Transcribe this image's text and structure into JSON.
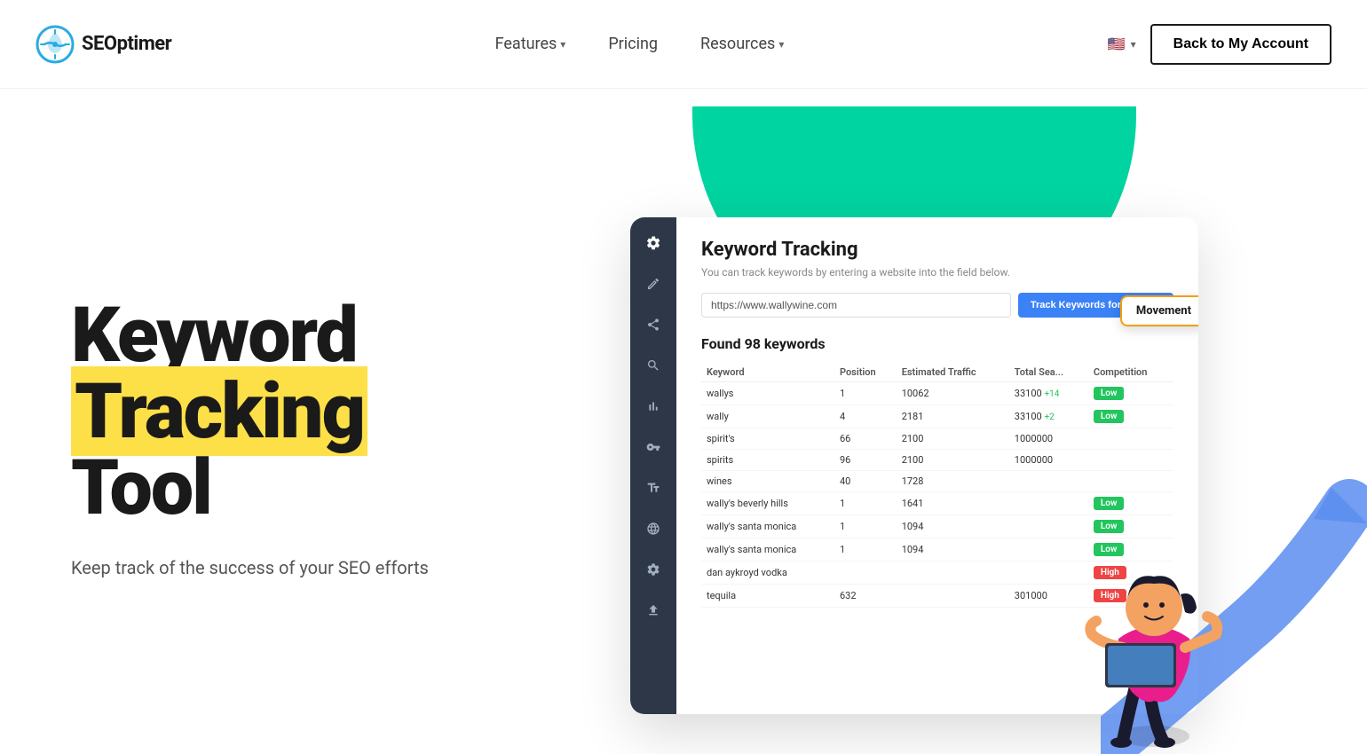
{
  "nav": {
    "logo_text": "SEOptimer",
    "features_label": "Features",
    "pricing_label": "Pricing",
    "resources_label": "Resources",
    "back_btn_label": "Back to My Account",
    "language": "EN"
  },
  "hero": {
    "title_line1": "Keyword",
    "title_line2": "Tracking",
    "title_line3": "Tool",
    "subtitle": "Keep track of the success of your SEO efforts"
  },
  "dashboard": {
    "title": "Keyword Tracking",
    "subtitle": "You can track keywords by entering a website into the field below.",
    "input_value": "https://www.wallywine.com",
    "track_btn_label": "Track Keywords for Website",
    "found_text": "Found 98 keywords",
    "movement_label": "Movement",
    "columns": [
      "Keyword",
      "Position",
      "Estimated Traffic",
      "Total Sea...",
      "Competition"
    ],
    "rows": [
      {
        "keyword": "wallys",
        "position": "1",
        "traffic": "10062",
        "total": "33100",
        "movement": "+14",
        "move_type": "up",
        "competition": "Low",
        "comp_type": "low"
      },
      {
        "keyword": "wally",
        "position": "4",
        "traffic": "2181",
        "total": "33100",
        "movement": "+2",
        "move_type": "up",
        "competition": "Low",
        "comp_type": "low"
      },
      {
        "keyword": "spirit's",
        "position": "66",
        "traffic": "2100",
        "total": "1000000",
        "movement": "",
        "move_type": "",
        "competition": "",
        "comp_type": ""
      },
      {
        "keyword": "spirits",
        "position": "96",
        "traffic": "2100",
        "total": "1000000",
        "movement": "",
        "move_type": "",
        "competition": "",
        "comp_type": ""
      },
      {
        "keyword": "wines",
        "position": "40",
        "traffic": "1728",
        "total": "",
        "movement": "",
        "move_type": "",
        "competition": "",
        "comp_type": ""
      },
      {
        "keyword": "wally's beverly hills",
        "position": "1",
        "traffic": "1641",
        "total": "",
        "movement": "",
        "move_type": "",
        "competition": "Low",
        "comp_type": "low"
      },
      {
        "keyword": "wally's santa monica",
        "position": "1",
        "traffic": "1094",
        "total": "",
        "movement": "",
        "move_type": "",
        "competition": "Low",
        "comp_type": "low"
      },
      {
        "keyword": "wally's santa monica",
        "position": "1",
        "traffic": "1094",
        "total": "",
        "movement": "",
        "move_type": "",
        "competition": "Low",
        "comp_type": "low"
      },
      {
        "keyword": "dan aykroyd vodka",
        "position": "",
        "traffic": "",
        "total": "",
        "movement": "",
        "move_type": "",
        "competition": "High",
        "comp_type": "high"
      },
      {
        "keyword": "tequila",
        "position": "632",
        "traffic": "",
        "total": "301000",
        "movement": "",
        "move_type": "",
        "competition": "High",
        "comp_type": "high"
      }
    ]
  }
}
